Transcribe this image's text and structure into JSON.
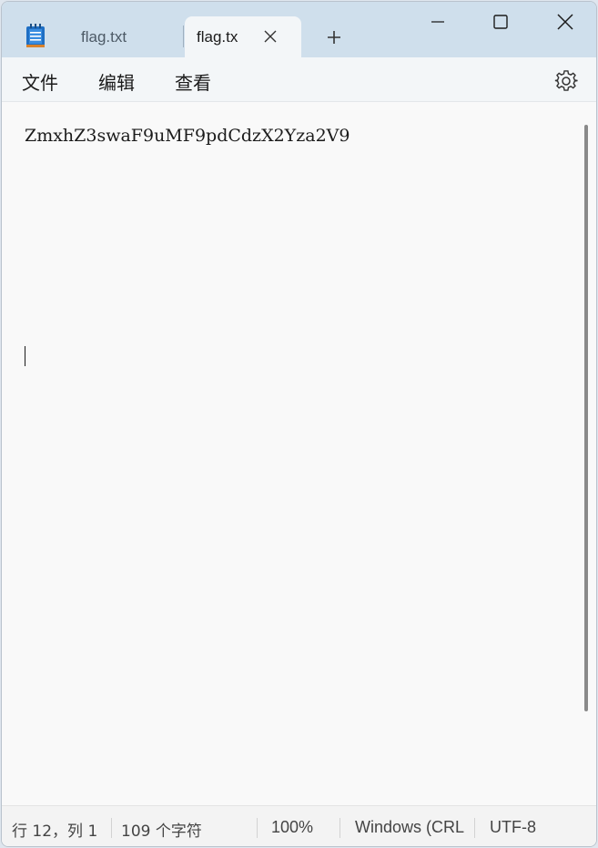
{
  "tabs": [
    {
      "label": "flag.txt",
      "active": false
    },
    {
      "label": "flag.tx",
      "active": true
    }
  ],
  "menu": {
    "file": "文件",
    "edit": "编辑",
    "view": "查看"
  },
  "editor": {
    "content": "ZmxhZ3swaF9uMF9pdCdzX2Yza2V9"
  },
  "status": {
    "position": "行 12，列 1",
    "char_count": "109 个字符",
    "zoom": "100%",
    "line_ending": "Windows (CRLF)",
    "encoding": "UTF-8"
  },
  "icons": {
    "app": "notepad-icon",
    "tab_close": "close-icon",
    "new_tab": "plus-icon",
    "minimize": "minimize-icon",
    "maximize": "maximize-icon",
    "close": "close-icon",
    "settings": "gear-icon"
  },
  "colors": {
    "titlebar": "#cfdfec",
    "editor_bg": "#f9f9f9",
    "accent_icon": "#1f6fc4"
  }
}
